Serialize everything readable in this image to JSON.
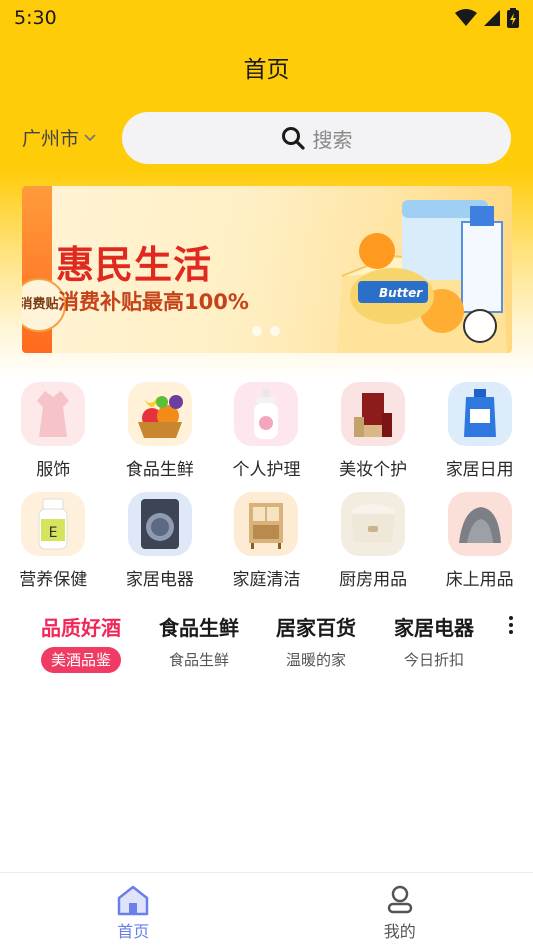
{
  "status_bar": {
    "time": "5:30"
  },
  "header": {
    "title": "首页"
  },
  "location": {
    "city": "广州市"
  },
  "search": {
    "placeholder": "搜索"
  },
  "banner": {
    "badge": "消费贴",
    "title": "惠民生活",
    "subtitle": "消费补贴最高100%",
    "product_label": "Butter",
    "slide_count": 2
  },
  "categories": [
    {
      "label": "服饰",
      "icon": "dress-icon"
    },
    {
      "label": "食品生鲜",
      "icon": "fruit-basket-icon"
    },
    {
      "label": "个人护理",
      "icon": "lotion-bottle-icon"
    },
    {
      "label": "美妆个护",
      "icon": "cosmetics-icon"
    },
    {
      "label": "家居日用",
      "icon": "detergent-icon"
    },
    {
      "label": "营养保健",
      "icon": "supplement-bottle-icon"
    },
    {
      "label": "家居电器",
      "icon": "washing-machine-icon"
    },
    {
      "label": "家庭清洁",
      "icon": "shelf-icon"
    },
    {
      "label": "厨房用品",
      "icon": "rice-cooker-icon"
    },
    {
      "label": "床上用品",
      "icon": "bedding-icon"
    }
  ],
  "tabs": [
    {
      "title": "品质好酒",
      "subtitle": "美酒品鉴",
      "active": true
    },
    {
      "title": "食品生鲜",
      "subtitle": "食品生鲜",
      "active": false
    },
    {
      "title": "居家百货",
      "subtitle": "温暖的家",
      "active": false
    },
    {
      "title": "家居电器",
      "subtitle": "今日折扣",
      "active": false
    }
  ],
  "bottom_nav": [
    {
      "label": "首页",
      "icon": "home-icon",
      "active": true
    },
    {
      "label": "我的",
      "icon": "profile-icon",
      "active": false
    }
  ],
  "colors": {
    "header_yellow": "#ffcc0a",
    "accent_pink": "#f03c64",
    "nav_active": "#6a7fe8"
  }
}
